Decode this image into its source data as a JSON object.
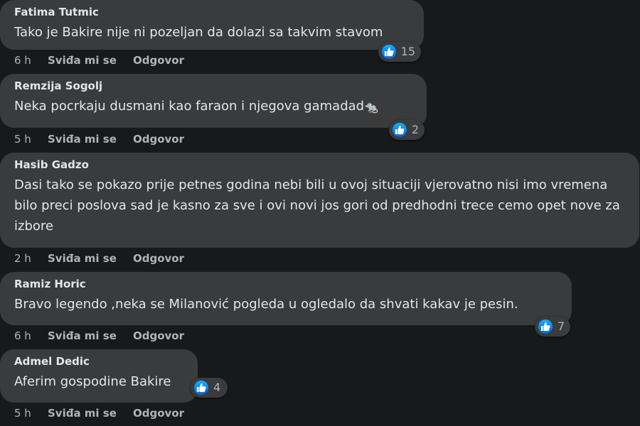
{
  "comments": [
    {
      "author": "Fatima Tutmic",
      "text": "Tako je Bakire nije ni pozeljan da dolazi sa takvim stavom",
      "time": "6 h",
      "like_label": "Sviđa mi se",
      "reply_label": "Odgovor",
      "reaction_count": "15",
      "reaction_icon": "like-icon"
    },
    {
      "author": "Remzija Sogolj",
      "text": "Neka pocrkaju dusmani kao faraon i njegova gamadad",
      "emoji": "🐀",
      "time": "5 h",
      "like_label": "Sviđa mi se",
      "reply_label": "Odgovor",
      "reaction_count": "2",
      "reaction_icon": "like-icon"
    },
    {
      "author": "Hasib Gadzo",
      "text": "Dasi tako se pokazo prije petnes godina nebi bili u ovoj situaciji vjerovatno nisi imo vremena bilo preci poslova sad je kasno za sve i ovi novi jos gori od predhodni trece cemo opet nove za izbore",
      "time": "2 h",
      "like_label": "Sviđa mi se",
      "reply_label": "Odgovor"
    },
    {
      "author": "Ramiz Horic",
      "text": "Bravo legendo ,neka se Milanović pogleda u ogledalo da shvati kakav je pesin.",
      "time": "6 h",
      "like_label": "Sviđa mi se",
      "reply_label": "Odgovor",
      "reaction_count": "7",
      "reaction_icon": "like-icon"
    },
    {
      "author": "Admel Dedic",
      "text": "Aferim gospodine Bakire",
      "time": "5 h",
      "like_label": "Sviđa mi se",
      "reply_label": "Odgovor",
      "reaction_count": "4",
      "reaction_icon": "like-icon"
    }
  ],
  "colors": {
    "background": "#18191a",
    "bubble": "#3a3b3c",
    "primary_text": "#e4e6eb",
    "secondary_text": "#b0b3b8",
    "like_blue": "#1877f2"
  }
}
